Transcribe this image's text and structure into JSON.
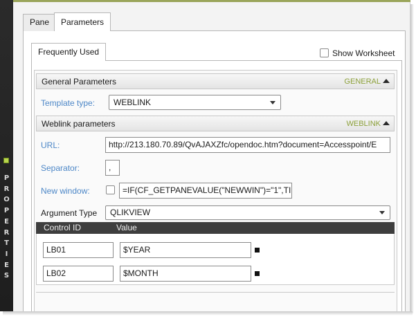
{
  "side_panel": {
    "label": "PROPERTIES"
  },
  "tabs": [
    {
      "label": "Pane"
    },
    {
      "label": "Parameters"
    }
  ],
  "inner_tab": {
    "label": "Frequently Used"
  },
  "show_worksheet": {
    "label": "Show Worksheet",
    "checked": false
  },
  "general": {
    "title": "General Parameters",
    "tag": "GENERAL",
    "template_type_label": "Template type:",
    "template_type_value": "WEBLINK"
  },
  "weblink": {
    "title": "Weblink parameters",
    "tag": "WEBLINK",
    "url_label": "URL:",
    "url_value": "http://213.180.70.89/QvAJAXZfc/opendoc.htm?document=Accesspoint/E",
    "separator_label": "Separator:",
    "separator_value": ",",
    "new_window_label": "New window:",
    "new_window_checked": false,
    "new_window_value": "=IF(CF_GETPANEVALUE(\"NEWWIN\")=\"1\",TI"
  },
  "argument_type": {
    "label": "Argument Type",
    "value": "QLIKVIEW"
  },
  "grid": {
    "columns": [
      "Control ID",
      "Value"
    ],
    "rows": [
      {
        "control_id": "LB01",
        "value": "$YEAR"
      },
      {
        "control_id": "LB02",
        "value": "$MONTH"
      }
    ]
  },
  "colors": {
    "accent_tag": "#8ca03a",
    "label_blue": "#4d87c7",
    "header_dark": "#3e3e3e"
  }
}
